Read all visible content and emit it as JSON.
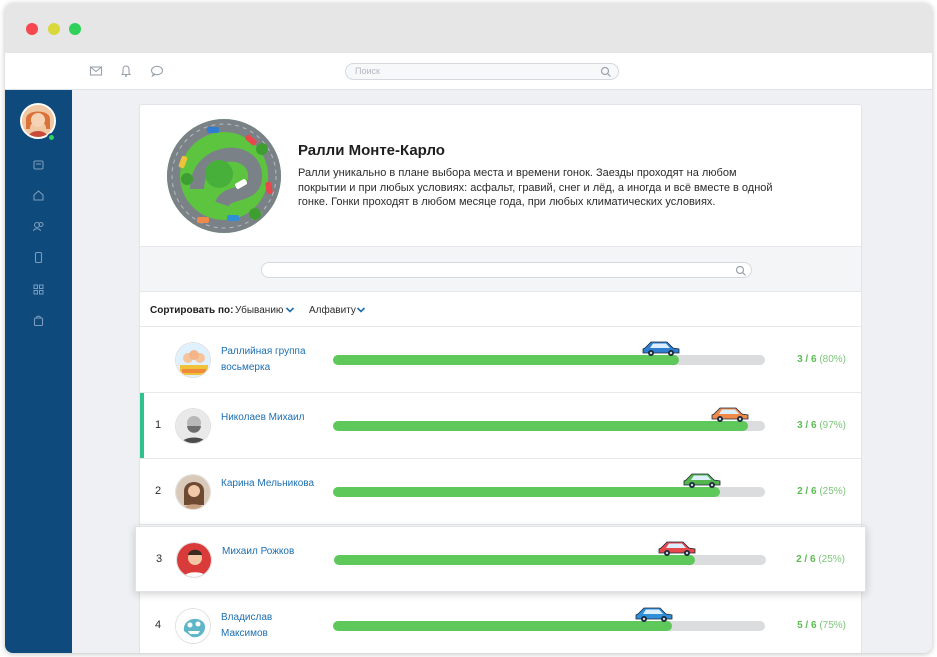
{
  "topbar": {
    "search_placeholder": "Поиск"
  },
  "hero": {
    "title": "Ралли Монте-Карло",
    "description": "Ралли уникально в плане выбора места и времени гонок. Заезды проходят на любом покрытии и при любых условиях: асфальт, гравий, снег и лёд, а иногда и всё вместе в одной гонке. Гонки проходят в любом месяце года, при любых климатических условиях."
  },
  "sort": {
    "label": "Сортировать по:",
    "option1": "Убыванию",
    "option2": "Алфавиту"
  },
  "rows": [
    {
      "rank": "",
      "name": "Раллийная группа восьмерка",
      "score": "3 / 6",
      "percent": "(80%)",
      "progress": 0.8,
      "car_color": "#2e7dd1",
      "active": false,
      "highlight": false
    },
    {
      "rank": "1",
      "name": "Николаев Михаил",
      "score": "3 / 6",
      "percent": "(97%)",
      "progress": 0.96,
      "car_color": "#f08a4b",
      "active": true,
      "highlight": false
    },
    {
      "rank": "2",
      "name": "Карина Мельникова",
      "score": "2 / 6",
      "percent": "(25%)",
      "progress": 0.895,
      "car_color": "#55b54f",
      "active": false,
      "highlight": false
    },
    {
      "rank": "3",
      "name": "Михаил Рожков",
      "score": "2 / 6",
      "percent": "(25%)",
      "progress": 0.835,
      "car_color": "#e8474c",
      "active": false,
      "highlight": true
    },
    {
      "rank": "4",
      "name": "Владислав Максимов",
      "score": "5 / 6",
      "percent": "(75%)",
      "progress": 0.785,
      "car_color": "#2f8fd8",
      "active": false,
      "highlight": false
    }
  ]
}
